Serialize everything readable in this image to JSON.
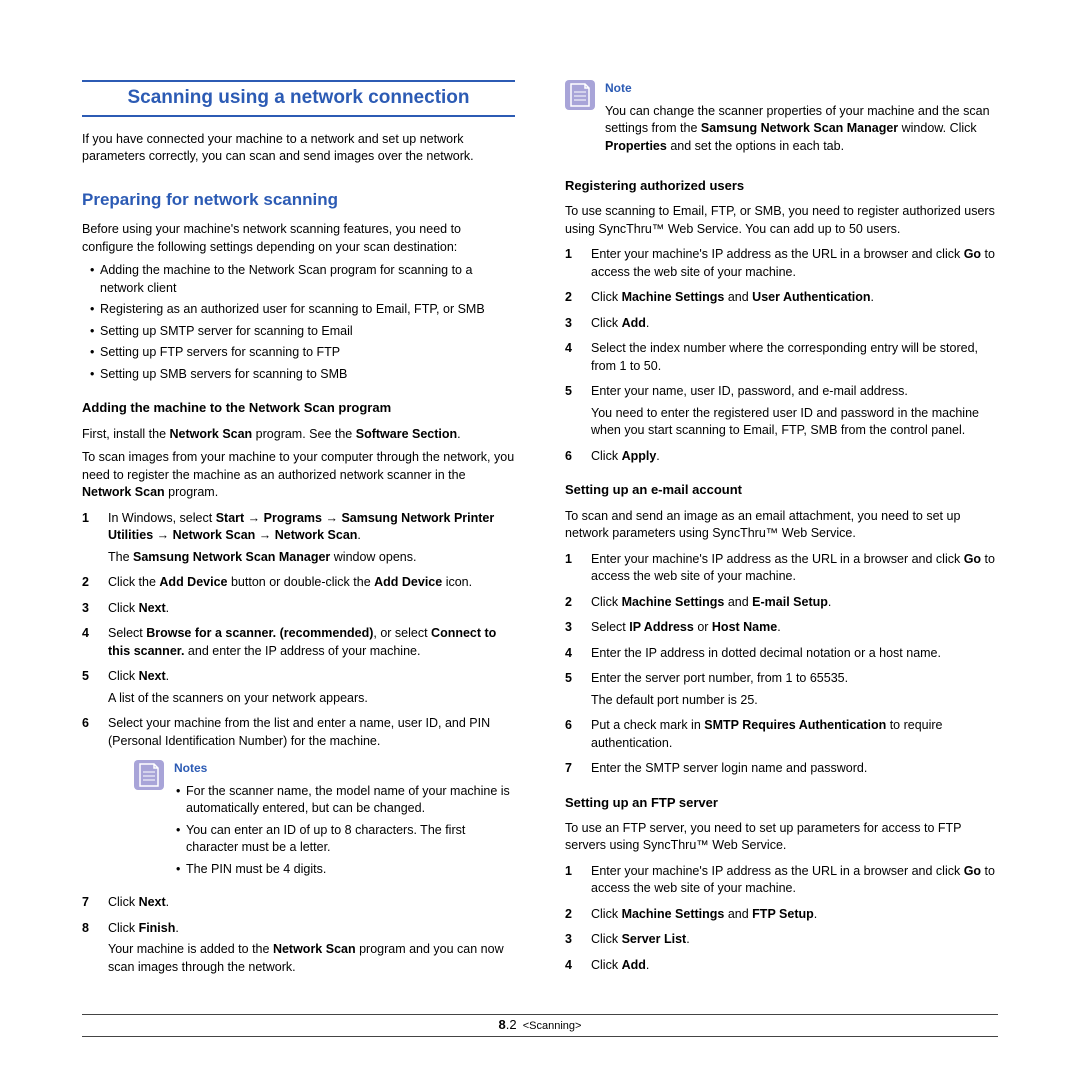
{
  "left": {
    "title": "Scanning using a network connection",
    "intro": "If you have connected your machine to a network and set up network parameters correctly, you can scan and send images over the network.",
    "h2": "Preparing for network scanning",
    "prep_intro": "Before using your machine's network scanning features, you need to configure the following settings depending on your scan destination:",
    "prep_bullets": [
      "Adding the machine to the Network Scan program for scanning to a network client",
      "Registering as an authorized user for scanning to Email, FTP, or SMB",
      "Setting up SMTP server for scanning to Email",
      "Setting up FTP servers for scanning to FTP",
      "Setting up SMB servers for scanning to SMB"
    ],
    "h3_add": "Adding the machine to the Network Scan program",
    "add_p1a": "First, install the ",
    "add_p1b": "Network Scan",
    "add_p1c": " program. See the ",
    "add_p1d": "Software Section",
    "add_p1e": ".",
    "add_p2a": "To scan images from your machine to your computer through the network, you need to register the machine as an authorized network scanner in the ",
    "add_p2b": "Network Scan",
    "add_p2c": " program.",
    "step1a": "In Windows, select ",
    "step1b": "Start",
    "step1c": "Programs",
    "step1d": "Samsung Network Printer Utilities",
    "step1e": "Network Scan",
    "step1f": "Network Scan",
    "step1g": ".",
    "step1_p2a": "The ",
    "step1_p2b": "Samsung Network Scan Manager",
    "step1_p2c": " window opens.",
    "step2a": "Click the ",
    "step2b": "Add Device",
    "step2c": " button or double-click the ",
    "step2d": "Add Device",
    "step2e": " icon.",
    "step3a": "Click ",
    "step3b": "Next",
    "step3c": ".",
    "step4a": "Select ",
    "step4b": "Browse for a scanner. (recommended)",
    "step4c": ", or select ",
    "step4d": "Connect to this scanner.",
    "step4e": " and enter the IP address of your machine.",
    "step5a": "Click ",
    "step5b": "Next",
    "step5c": ".",
    "step5_p2": "A list of the scanners on your network appears.",
    "step6": "Select your machine from the list and enter a name, user ID, and PIN (Personal Identification Number) for the machine.",
    "notes_label": "Notes",
    "notes": [
      "For the scanner name, the model name of your machine is automatically entered, but can be changed.",
      "You can enter an ID of up to 8 characters. The first character must be a letter.",
      "The PIN must be 4 digits."
    ],
    "step7a": "Click ",
    "step7b": "Next",
    "step7c": ".",
    "step8a": "Click ",
    "step8b": "Finish",
    "step8c": ".",
    "step8_p2a": "Your machine is added to the ",
    "step8_p2b": "Network Scan",
    "step8_p2c": " program and you can now scan images through the network."
  },
  "right": {
    "note_label": "Note",
    "note_text_a": "You can change the scanner properties of your machine and the scan settings from the ",
    "note_text_b": "Samsung Network Scan Manager",
    "note_text_c": " window. Click ",
    "note_text_d": "Properties",
    "note_text_e": " and set the options in each tab.",
    "h3_reg": "Registering authorized users",
    "reg_intro": "To use scanning to Email, FTP, or SMB, you need to register authorized users using SyncThru™ Web Service. You can add up to 50 users.",
    "reg1a": "Enter your machine's IP address as the URL in a browser and click ",
    "reg1b": "Go",
    "reg1c": " to access the web site of your machine.",
    "reg2a": "Click ",
    "reg2b": "Machine Settings",
    "reg2c": " and ",
    "reg2d": "User Authentication",
    "reg2e": ".",
    "reg3a": "Click ",
    "reg3b": "Add",
    "reg3c": ".",
    "reg4": "Select the index number where the corresponding entry will be stored, from 1 to 50.",
    "reg5": "Enter your name, user ID, password, and e-mail address.",
    "reg5_p2": "You need to enter the registered user ID and password in the machine when you start scanning to Email, FTP, SMB from the control panel.",
    "reg6a": "Click ",
    "reg6b": "Apply",
    "reg6c": ".",
    "h3_email": "Setting up an e-mail account",
    "email_intro": "To scan and send an image as an email attachment, you need to set up network parameters using SyncThru™ Web Service.",
    "em1a": "Enter your machine's IP address as the URL in a browser and click ",
    "em1b": "Go",
    "em1c": " to access the web site of your machine.",
    "em2a": "Click ",
    "em2b": "Machine Settings",
    "em2c": " and ",
    "em2d": "E-mail Setup",
    "em2e": ".",
    "em3a": "Select ",
    "em3b": "IP Address",
    "em3c": " or ",
    "em3d": "Host Name",
    "em3e": ".",
    "em4": "Enter the IP address in dotted decimal notation or a host name.",
    "em5": "Enter the server port number, from 1 to 65535.",
    "em5_p2": "The default port number is 25.",
    "em6a": "Put a check mark in ",
    "em6b": "SMTP Requires Authentication",
    "em6c": " to require authentication.",
    "em7": "Enter the SMTP server login name and password.",
    "h3_ftp": "Setting up an FTP server",
    "ftp_intro": "To use an FTP server, you need to set up parameters for access to FTP servers using SyncThru™ Web Service.",
    "ftp1a": "Enter your machine's IP address as the URL in a browser and click ",
    "ftp1b": "Go",
    "ftp1c": " to access the web site of your machine.",
    "ftp2a": "Click ",
    "ftp2b": "Machine Settings",
    "ftp2c": " and ",
    "ftp2d": "FTP Setup",
    "ftp2e": ".",
    "ftp3a": "Click ",
    "ftp3b": "Server List",
    "ftp3c": ".",
    "ftp4a": "Click ",
    "ftp4b": "Add",
    "ftp4c": "."
  },
  "footer": {
    "chapter": "8",
    "page": ".2",
    "section": "<Scanning>"
  }
}
